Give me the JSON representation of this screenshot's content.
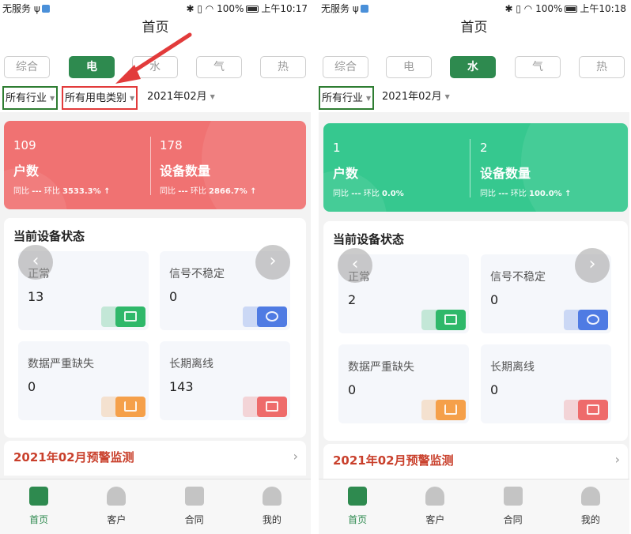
{
  "screens": [
    {
      "status": {
        "carrier": "无服务",
        "battery": "100%",
        "time": "上午10:17"
      },
      "title": "首页",
      "tabs": [
        "综合",
        "电",
        "水",
        "气",
        "热"
      ],
      "active_tab": 1,
      "filters": [
        "所有行业",
        "所有用电类别",
        "2021年02月"
      ],
      "summary": {
        "households": {
          "value": "109",
          "label": "户数",
          "yoy_label": "同比",
          "yoy_value": "---",
          "mom_label": "环比",
          "mom_value": "3533.3% ↑"
        },
        "devices": {
          "value": "178",
          "label": "设备数量",
          "yoy_label": "同比",
          "yoy_value": "---",
          "mom_label": "环比",
          "mom_value": "2866.7% ↑"
        }
      },
      "device_status": {
        "title": "当前设备状态",
        "items": [
          {
            "label": "正常",
            "value": "13"
          },
          {
            "label": "信号不稳定",
            "value": "0"
          },
          {
            "label": "数据严重缺失",
            "value": "0"
          },
          {
            "label": "长期离线",
            "value": "143"
          }
        ]
      },
      "warning": "2021年02月预警监测",
      "nav": [
        "首页",
        "客户",
        "合同",
        "我的"
      ]
    },
    {
      "status": {
        "carrier": "无服务",
        "battery": "100%",
        "time": "上午10:18"
      },
      "title": "首页",
      "tabs": [
        "综合",
        "电",
        "水",
        "气",
        "热"
      ],
      "active_tab": 2,
      "filters": [
        "所有行业",
        "2021年02月"
      ],
      "summary": {
        "households": {
          "value": "1",
          "label": "户数",
          "yoy_label": "同比",
          "yoy_value": "---",
          "mom_label": "环比",
          "mom_value": "0.0%"
        },
        "devices": {
          "value": "2",
          "label": "设备数量",
          "yoy_label": "同比",
          "yoy_value": "---",
          "mom_label": "环比",
          "mom_value": "100.0% ↑"
        }
      },
      "device_status": {
        "title": "当前设备状态",
        "items": [
          {
            "label": "正常",
            "value": "2"
          },
          {
            "label": "信号不稳定",
            "value": "0"
          },
          {
            "label": "数据严重缺失",
            "value": "0"
          },
          {
            "label": "长期离线",
            "value": "0"
          }
        ]
      },
      "warning": "2021年02月预警监测",
      "nav": [
        "首页",
        "客户",
        "合同",
        "我的"
      ]
    }
  ],
  "colors": {
    "accent": "#2e8a4f",
    "electric_card": "#f07272",
    "water_card": "#36c88f",
    "warning_text": "#c9402c",
    "highlight_green": "#2e7d32",
    "highlight_red": "#e23b3b"
  },
  "icons": [
    "bluetooth-icon",
    "vibrate-icon",
    "wifi-icon",
    "battery-icon",
    "home-icon",
    "customer-icon",
    "contract-icon",
    "profile-icon",
    "chevron-left-icon",
    "chevron-right-icon",
    "chevron-right-small-icon"
  ]
}
